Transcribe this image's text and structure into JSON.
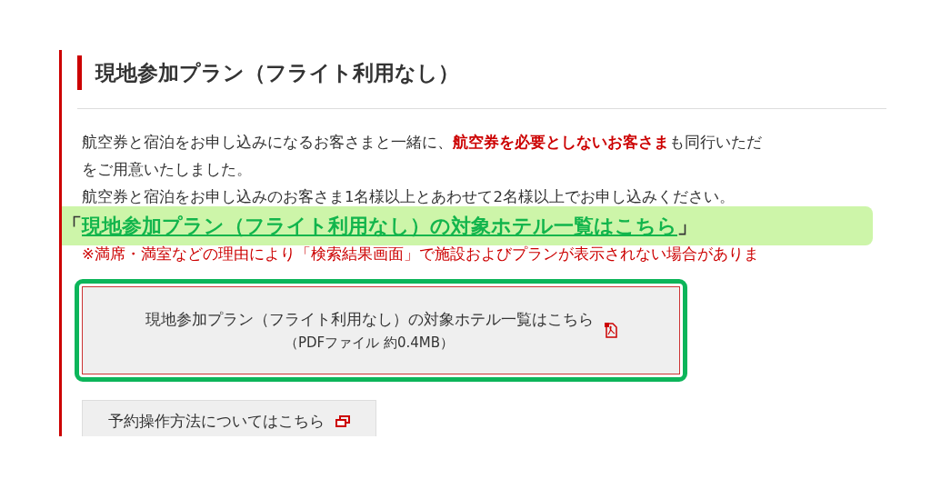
{
  "heading": "現地参加プラン（フライト利用なし）",
  "paragraph": [
    {
      "text": "航空券と宿泊をお申し込みになるお客さまと一緒に、**航空券を必要としないお客さま**も同行いただ",
      "kind": "normal"
    },
    {
      "text": "をご用意いたしました。",
      "kind": "normal"
    },
    {
      "text": "航空券と宿泊をお申し込みのお客さま1名様以上とあわせて2名様以上でお申し込みください。",
      "kind": "normal"
    },
    {
      "text": "※満席・満室などの理由により「検索結果画面」で施設およびプランが表示されない場合がありま",
      "kind": "note"
    }
  ],
  "callout": {
    "open": "「",
    "link": "現地参加プラン（フライト利用なし）の対象ホテル一覧はこちら",
    "close": "」"
  },
  "buttons": [
    {
      "label": "現地参加プラン（フライト利用なし）の対象ホテル一覧はこちら",
      "sub": "（PDFファイル 約0.4MB）",
      "kind": "pdf",
      "highlighted": true
    },
    {
      "label": "予約操作方法についてはこちら",
      "kind": "external",
      "highlighted": false
    }
  ]
}
